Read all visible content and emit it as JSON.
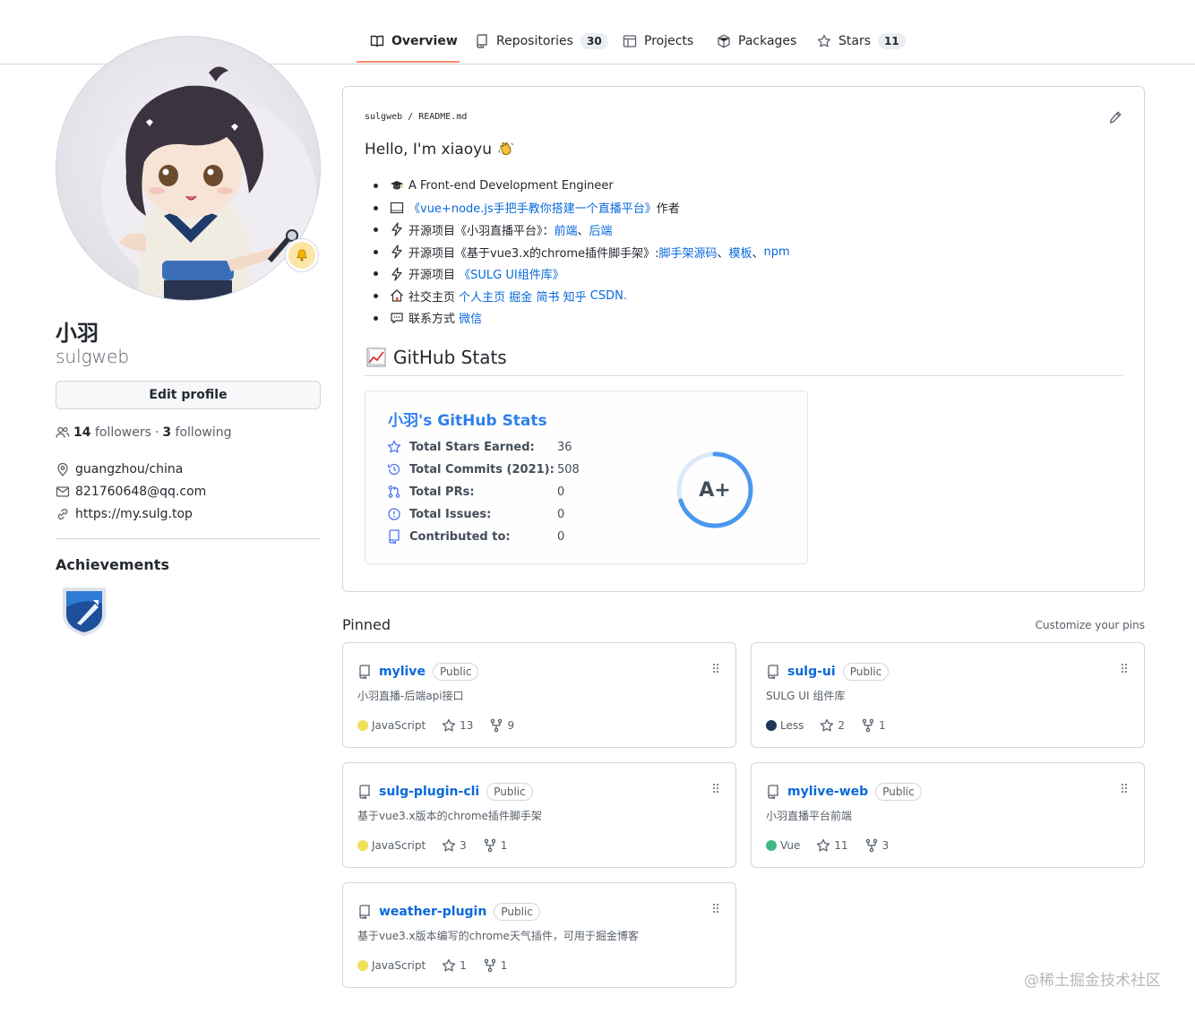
{
  "nav": {
    "tabs": [
      {
        "label": "Overview",
        "icon": "book-icon"
      },
      {
        "label": "Repositories",
        "icon": "repo-icon",
        "count": "30"
      },
      {
        "label": "Projects",
        "icon": "table-icon"
      },
      {
        "label": "Packages",
        "icon": "package-icon"
      },
      {
        "label": "Stars",
        "icon": "star-icon",
        "count": "11"
      }
    ],
    "active_tab": "Overview",
    "accent": "#fd8c73"
  },
  "profile": {
    "fullname": "小羽",
    "login": "sulgweb",
    "edit_label": "Edit profile",
    "followers_count": "14",
    "followers_label": "followers",
    "separator": "·",
    "following_count": "3",
    "following_label": "following",
    "location": "guangzhou/china",
    "email": "821760648@qq.com",
    "website": "https://my.sulg.top",
    "achievements_title": "Achievements"
  },
  "readme": {
    "path": "sulgweb / README.md",
    "hello": "Hello, I'm xiaoyu",
    "items": [
      {
        "icon": "graduation-cap-icon",
        "parts": [
          {
            "t": "A Front-end Development Engineer"
          }
        ]
      },
      {
        "icon": "book-icon",
        "parts": [
          {
            "t": "《vue+node.js手把手教你搭建一个直播平台》",
            "link": true
          },
          {
            "t": "作者"
          }
        ]
      },
      {
        "icon": "lightning-icon",
        "parts": [
          {
            "t": "开源项目《小羽直播平台》："
          },
          {
            "t": "前端",
            "link": true
          },
          {
            "t": "、"
          },
          {
            "t": "后端",
            "link": true
          }
        ]
      },
      {
        "icon": "lightning-icon",
        "parts": [
          {
            "t": "开源项目《基于vue3.x的chrome插件脚手架》:"
          },
          {
            "t": "脚手架源码",
            "link": true
          },
          {
            "t": "、"
          },
          {
            "t": "模板",
            "link": true
          },
          {
            "t": "、"
          },
          {
            "t": "npm",
            "link": true
          }
        ]
      },
      {
        "icon": "lightning-icon",
        "parts": [
          {
            "t": "开源项目 "
          },
          {
            "t": "《SULG UI组件库》",
            "link": true
          }
        ]
      },
      {
        "icon": "house-icon",
        "parts": [
          {
            "t": "社交主页 "
          },
          {
            "t": "个人主页",
            "link": true
          },
          {
            "t": " "
          },
          {
            "t": "掘金",
            "link": true
          },
          {
            "t": " "
          },
          {
            "t": "简书",
            "link": true
          },
          {
            "t": " "
          },
          {
            "t": "知乎",
            "link": true
          },
          {
            "t": " "
          },
          {
            "t": "CSDN.",
            "link": true
          }
        ]
      },
      {
        "icon": "speech-bubble-icon",
        "parts": [
          {
            "t": "联系方式 "
          },
          {
            "t": "微信",
            "link": true
          }
        ]
      }
    ],
    "stats_heading": "GitHub Stats"
  },
  "stats_card": {
    "title": "小羽's GitHub Stats",
    "rows": [
      {
        "icon": "star-icon",
        "label": "Total Stars Earned:",
        "value": "36"
      },
      {
        "icon": "history-icon",
        "label": "Total Commits (2021):",
        "value": "508"
      },
      {
        "icon": "pull-request-icon",
        "label": "Total PRs:",
        "value": "0"
      },
      {
        "icon": "issue-icon",
        "label": "Total Issues:",
        "value": "0"
      },
      {
        "icon": "repo-icon",
        "label": "Contributed to:",
        "value": "0"
      }
    ],
    "rank": "A+",
    "rank_progress": 0.7,
    "title_color": "#2f80ed",
    "ring_color": "#4c97f0"
  },
  "pinned": {
    "heading": "Pinned",
    "customize_label": "Customize your pins",
    "repos": [
      {
        "name": "mylive",
        "visibility": "Public",
        "description": "小羽直播-后端api接口",
        "language": "JavaScript",
        "lang_color": "#f1e05a",
        "stars": "13",
        "forks": "9"
      },
      {
        "name": "sulg-ui",
        "visibility": "Public",
        "description": "SULG UI 组件库",
        "language": "Less",
        "lang_color": "#1d365d",
        "stars": "2",
        "forks": "1"
      },
      {
        "name": "sulg-plugin-cli",
        "visibility": "Public",
        "description": "基于vue3.x版本的chrome插件脚手架",
        "language": "JavaScript",
        "lang_color": "#f1e05a",
        "stars": "3",
        "forks": "1"
      },
      {
        "name": "mylive-web",
        "visibility": "Public",
        "description": "小羽直播平台前端",
        "language": "Vue",
        "lang_color": "#41b883",
        "stars": "11",
        "forks": "3"
      },
      {
        "name": "weather-plugin",
        "visibility": "Public",
        "description": "基于vue3.x版本编写的chrome天气插件，可用于掘金博客",
        "language": "JavaScript",
        "lang_color": "#f1e05a",
        "stars": "1",
        "forks": "1"
      }
    ]
  },
  "watermark": "@稀土掘金技术社区"
}
